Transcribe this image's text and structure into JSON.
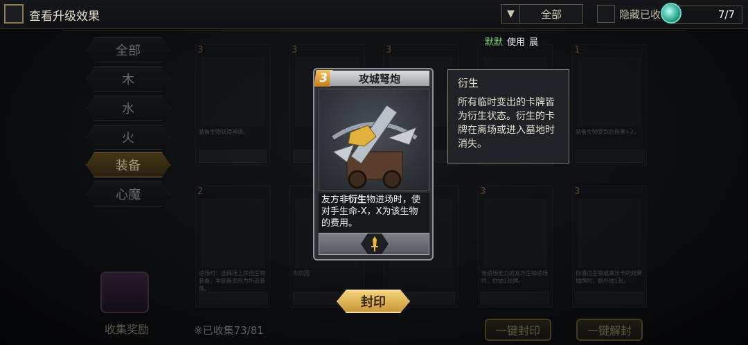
{
  "header": {
    "title": "查看升级效果",
    "filter_value": "全部",
    "hide_label": "隐藏已收",
    "counter": "7/7"
  },
  "user": {
    "name": "默默",
    "use_label": "使用",
    "time": "晨"
  },
  "categories": [
    {
      "label": "全部"
    },
    {
      "label": "木"
    },
    {
      "label": "水"
    },
    {
      "label": "火"
    },
    {
      "label": "装备",
      "active": true
    },
    {
      "label": "心魔"
    }
  ],
  "grid": [
    {
      "cost": "3",
      "name": "",
      "desc": "装备生物获得神速。"
    },
    {
      "cost": "3",
      "name": "",
      "desc": ""
    },
    {
      "cost": "3",
      "name": "",
      "desc": ""
    },
    {
      "cost": "",
      "name": "",
      "desc": ""
    },
    {
      "cost": "1",
      "name": "",
      "desc": "装备生物受到的伤害+2。"
    },
    {
      "cost": "2",
      "name": "",
      "desc": "进场时：选择场上其他生物装备，本装备变形为所选装备。"
    },
    {
      "cost": "",
      "name": "",
      "desc": "你的团"
    },
    {
      "cost": "",
      "name": "",
      "desc": ""
    },
    {
      "cost": "3",
      "name": "",
      "desc": "有进场能力的友方生物进场时，你抽1张牌。"
    },
    {
      "cost": "3",
      "name": "",
      "desc": "你通过生物或魔法卡的效果抽牌时，额外抽1张。"
    }
  ],
  "footer": {
    "collected": "※已收集73/81",
    "reward": "收集奖励",
    "seal_all": "一键封印",
    "unseal_all": "一键解封"
  },
  "featured": {
    "cost": "3",
    "name": "攻城弩炮",
    "desc_1": "友方非",
    "desc_keyword": "衍生",
    "desc_2": "物进场时，使对手生命-X，X为该生物的费用。",
    "type_icon": "sword-icon"
  },
  "tooltip": {
    "title": "衍生",
    "body": "所有临时变出的卡牌皆为衍生状态。衍生的卡牌在离场或进入墓地时消失。"
  },
  "seal_button": "封印"
}
